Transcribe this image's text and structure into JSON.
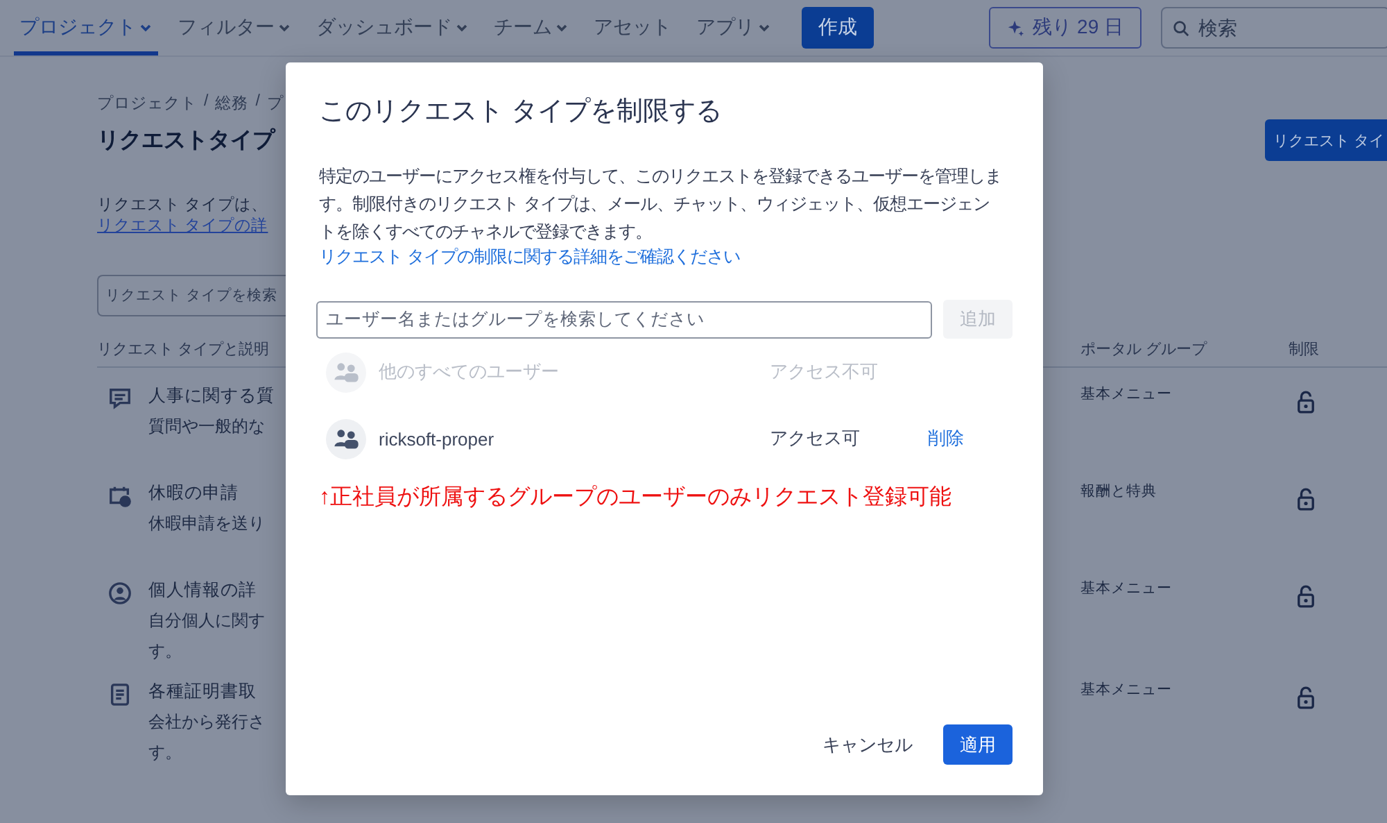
{
  "nav": {
    "items": [
      {
        "label": "プロジェクト",
        "selected": true,
        "dropdown": true
      },
      {
        "label": "フィルター",
        "selected": false,
        "dropdown": true
      },
      {
        "label": "ダッシュボード",
        "selected": false,
        "dropdown": true
      },
      {
        "label": "チーム",
        "selected": false,
        "dropdown": true
      },
      {
        "label": "アセット",
        "selected": false,
        "dropdown": false
      },
      {
        "label": "アプリ",
        "selected": false,
        "dropdown": true
      }
    ],
    "create_button": "作成",
    "trial_button": "残り 29 日",
    "search": {
      "placeholder": "検索"
    }
  },
  "page": {
    "breadcrumb": [
      "プロジェクト",
      "総務",
      "プ"
    ],
    "breadcrumb_separator": "/",
    "title": "リクエストタイプ",
    "description": "リクエスト タイプは、",
    "link": "リクエスト タイプの詳",
    "search": {
      "placeholder": "リクエスト タイプを検索"
    },
    "add_button": "リクエスト タイ",
    "columns": [
      "リクエスト タイプと説明",
      "ポータル グループ",
      "制限"
    ],
    "rows": [
      {
        "kind": "chat",
        "name": "人事に関する質",
        "description": [
          "質問や一般的な"
        ],
        "portal_group": "基本メニュー",
        "locked": false
      },
      {
        "kind": "calendar",
        "name": "休暇の申請",
        "description": [
          "休暇申請を送り"
        ],
        "portal_group": "報酬と特典",
        "locked": false
      },
      {
        "kind": "person",
        "name": "個人情報の詳",
        "description": [
          "自分個人に関す",
          "す。"
        ],
        "portal_group": "基本メニュー",
        "locked": false
      },
      {
        "kind": "document",
        "name": "各種証明書取",
        "description": [
          "会社から発行さ",
          "す。"
        ],
        "portal_group": "基本メニュー",
        "locked": false
      }
    ]
  },
  "dialog": {
    "title": "このリクエスト タイプを制限する",
    "body": "特定のユーザーにアクセス権を付与して、このリクエストを登録できるユーザーを管理します。制限付きのリクエスト タイプは、メール、チャット、ウィジェット、仮想エージェントを除くすべてのチャネルで登録できます。",
    "link": "リクエスト タイプの制限に関する詳細をご確認ください",
    "field": {
      "placeholder": "ユーザー名またはグループを検索してください"
    },
    "add_button": {
      "label": "追加",
      "disabled": true
    },
    "entries": [
      {
        "name": "他のすべてのユーザー",
        "access": "アクセス不可",
        "disabled": true
      },
      {
        "name": "ricksoft-proper",
        "access": "アクセス可",
        "disabled": false,
        "remove": "削除"
      }
    ],
    "note": "↑正社員が所属するグループのユーザーのみリクエスト登録可能",
    "cancel_button": "キャンセル",
    "apply_button": "適用"
  }
}
